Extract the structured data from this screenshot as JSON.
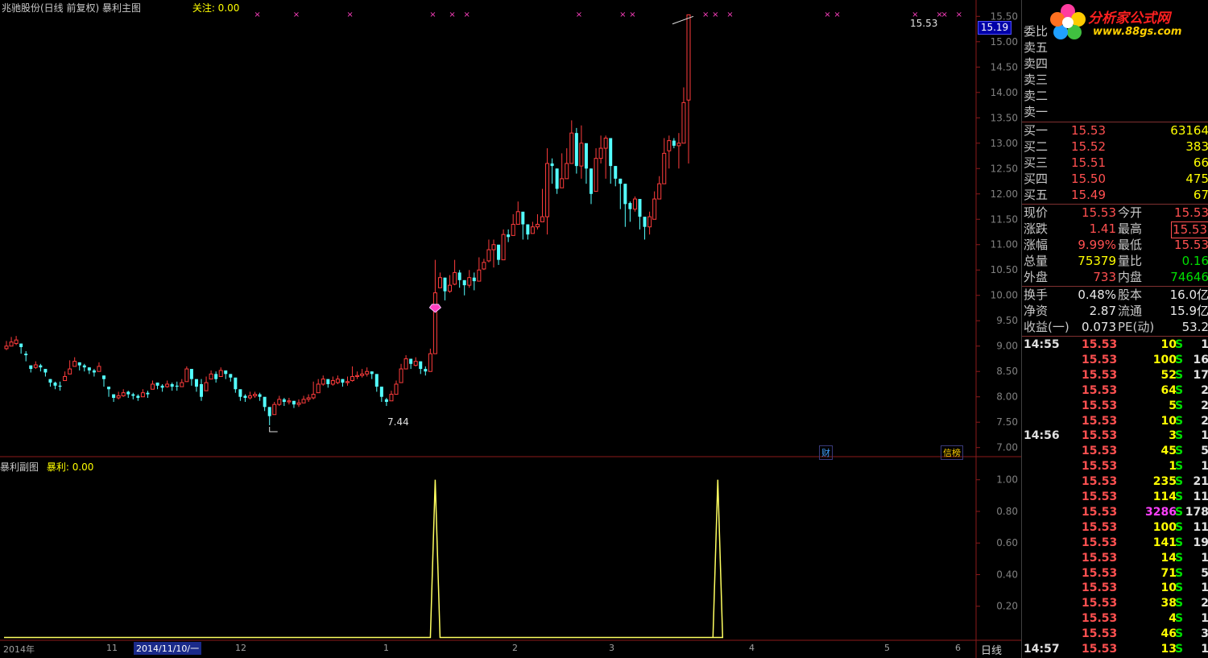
{
  "header": {
    "title": "兆驰股份(日线 前复权) 暴利主图",
    "focus_label": "关注: 0.00"
  },
  "sub_header": {
    "title": "暴利副图",
    "value_label": "暴利: 0.00"
  },
  "price_tag": "15.19",
  "annotations": {
    "high_label": "15.53",
    "low_label": "7.44",
    "finance_flag": "财",
    "rank_flag": "信榜"
  },
  "period_label": "日线",
  "date_axis": {
    "year": "2014年",
    "m11": "11",
    "selected": "2014/11/10/一",
    "m12": "12",
    "m1": "1",
    "m2": "2",
    "m3": "3",
    "m4": "4",
    "m5": "5",
    "m6": "6"
  },
  "colors": {
    "up": "#ff3c3c",
    "down": "#54ffff",
    "indicator": "#ffff60",
    "marker": "#ff40c0",
    "grid": "#8b1a1a"
  },
  "chart_data": [
    {
      "type": "candlestick",
      "title": "兆驰股份(日线 前复权) 暴利主图",
      "ylim": [
        6.9,
        15.6
      ],
      "y_ticks": [
        "15.50",
        "15.00",
        "14.50",
        "14.00",
        "13.50",
        "13.00",
        "12.50",
        "12.00",
        "11.50",
        "11.00",
        "10.50",
        "10.00",
        "9.50",
        "9.00",
        "8.50",
        "8.00",
        "7.50",
        "7.00"
      ],
      "closes": [
        9.0,
        9.08,
        9.12,
        8.98,
        8.82,
        8.55,
        8.63,
        8.58,
        8.48,
        8.28,
        8.22,
        8.2,
        8.4,
        8.55,
        8.7,
        8.62,
        8.58,
        8.52,
        8.48,
        8.6,
        8.35,
        8.15,
        7.98,
        8.02,
        8.08,
        8.05,
        8.02,
        7.98,
        8.08,
        8.05,
        8.25,
        8.22,
        8.18,
        8.25,
        8.2,
        8.2,
        8.28,
        8.55,
        8.35,
        8.2,
        8.0,
        8.28,
        8.45,
        8.35,
        8.52,
        8.45,
        8.38,
        8.15,
        8.0,
        7.98,
        8.02,
        8.05,
        8.0,
        7.8,
        7.62,
        7.85,
        7.95,
        7.9,
        7.92,
        7.85,
        7.88,
        7.95,
        7.98,
        8.05,
        8.25,
        8.35,
        8.25,
        8.32,
        8.35,
        8.28,
        8.3,
        8.4,
        8.42,
        8.45,
        8.5,
        8.45,
        8.2,
        8.0,
        7.9,
        8.05,
        8.25,
        8.55,
        8.75,
        8.65,
        8.7,
        8.55,
        8.5,
        8.85,
        10.05,
        10.35,
        10.08,
        10.2,
        10.45,
        10.3,
        10.2,
        10.35,
        10.28,
        10.5,
        10.65,
        10.9,
        11.0,
        10.7,
        11.2,
        11.15,
        11.4,
        11.65,
        11.4,
        11.2,
        11.35,
        11.4,
        11.55,
        12.6,
        12.55,
        12.1,
        12.3,
        12.6,
        13.2,
        12.55,
        13.0,
        12.5,
        12.0,
        12.7,
        12.9,
        13.1,
        12.55,
        12.3,
        12.2,
        11.8,
        11.7,
        11.9,
        11.55,
        11.35,
        11.55,
        11.9,
        12.2,
        12.8,
        13.05,
        12.95,
        13.0,
        13.8,
        15.53
      ],
      "highs": [
        9.1,
        9.18,
        9.2,
        9.05,
        8.9,
        8.62,
        8.7,
        8.65,
        8.55,
        8.35,
        8.3,
        8.3,
        8.5,
        8.72,
        8.78,
        8.68,
        8.65,
        8.58,
        8.55,
        8.68,
        8.42,
        8.2,
        8.05,
        8.1,
        8.15,
        8.12,
        8.08,
        8.05,
        8.15,
        8.12,
        8.32,
        8.28,
        8.25,
        8.32,
        8.28,
        8.3,
        8.35,
        8.6,
        8.4,
        8.28,
        8.35,
        8.4,
        8.52,
        8.5,
        8.58,
        8.5,
        8.45,
        8.22,
        8.08,
        8.05,
        8.1,
        8.1,
        8.08,
        7.9,
        7.72,
        7.9,
        8.02,
        7.98,
        7.98,
        7.92,
        7.95,
        8.02,
        8.05,
        8.3,
        8.35,
        8.42,
        8.3,
        8.4,
        8.42,
        8.35,
        8.4,
        8.6,
        8.5,
        8.55,
        8.58,
        8.5,
        8.3,
        8.1,
        7.98,
        8.12,
        8.32,
        8.65,
        8.82,
        8.75,
        8.78,
        8.62,
        8.6,
        8.95,
        10.7,
        10.45,
        10.35,
        10.4,
        10.7,
        10.5,
        10.3,
        10.5,
        10.45,
        10.75,
        10.72,
        11.1,
        11.1,
        10.95,
        11.3,
        11.3,
        11.6,
        11.85,
        11.5,
        11.4,
        11.45,
        11.6,
        12.1,
        12.9,
        12.7,
        12.5,
        12.8,
        12.9,
        13.45,
        13.3,
        13.35,
        12.7,
        12.5,
        12.9,
        13.15,
        13.15,
        12.7,
        12.55,
        12.3,
        12.0,
        11.85,
        11.95,
        11.7,
        11.45,
        11.65,
        12.05,
        12.35,
        13.1,
        13.15,
        13.1,
        13.2,
        14.1,
        15.53
      ],
      "lows": [
        8.92,
        9.0,
        9.02,
        8.85,
        8.7,
        8.48,
        8.55,
        8.5,
        8.4,
        8.2,
        8.15,
        8.12,
        8.32,
        8.45,
        8.6,
        8.52,
        8.5,
        8.45,
        8.4,
        8.5,
        8.2,
        8.0,
        7.9,
        7.95,
        8.0,
        7.98,
        7.95,
        7.92,
        8.0,
        7.98,
        8.15,
        8.15,
        8.1,
        8.18,
        8.12,
        8.12,
        8.2,
        8.3,
        8.22,
        8.1,
        7.92,
        8.18,
        8.35,
        8.28,
        8.4,
        8.35,
        8.3,
        8.08,
        7.92,
        7.9,
        7.95,
        7.98,
        7.92,
        7.72,
        7.44,
        7.7,
        7.82,
        7.82,
        7.85,
        7.78,
        7.8,
        7.88,
        7.9,
        7.95,
        8.1,
        8.22,
        8.18,
        8.22,
        8.25,
        8.2,
        8.22,
        8.3,
        8.35,
        8.38,
        8.4,
        8.35,
        8.1,
        7.9,
        7.82,
        7.95,
        8.15,
        8.45,
        8.62,
        8.55,
        8.6,
        8.45,
        8.42,
        8.72,
        9.95,
        10.2,
        9.9,
        10.05,
        10.2,
        10.15,
        10.0,
        10.15,
        10.1,
        10.4,
        10.5,
        10.65,
        10.55,
        10.6,
        10.95,
        11.05,
        11.2,
        11.4,
        11.1,
        11.1,
        11.25,
        11.3,
        11.45,
        11.2,
        12.2,
        12.0,
        12.2,
        12.5,
        12.6,
        12.4,
        12.3,
        12.2,
        11.8,
        12.5,
        12.6,
        12.3,
        12.2,
        12.15,
        11.7,
        11.35,
        11.45,
        11.65,
        11.3,
        11.1,
        11.2,
        11.8,
        12.0,
        12.5,
        12.5,
        12.9,
        12.5,
        13.0,
        12.6
      ],
      "opens": [
        8.95,
        9.0,
        9.05,
        9.05,
        8.85,
        8.62,
        8.58,
        8.62,
        8.55,
        8.35,
        8.28,
        8.22,
        8.32,
        8.45,
        8.6,
        8.68,
        8.62,
        8.58,
        8.52,
        8.5,
        8.42,
        8.2,
        8.05,
        7.98,
        8.02,
        8.1,
        8.05,
        8.02,
        8.0,
        8.08,
        8.15,
        8.28,
        8.22,
        8.2,
        8.25,
        8.22,
        8.2,
        8.3,
        8.55,
        8.35,
        8.25,
        8.12,
        8.35,
        8.45,
        8.4,
        8.52,
        8.45,
        8.38,
        8.15,
        8.02,
        7.98,
        8.02,
        8.05,
        8.0,
        7.8,
        7.65,
        7.85,
        7.95,
        7.9,
        7.92,
        7.85,
        7.88,
        7.95,
        7.98,
        8.08,
        8.25,
        8.35,
        8.25,
        8.28,
        8.35,
        8.28,
        8.32,
        8.4,
        8.42,
        8.45,
        8.5,
        8.45,
        8.2,
        7.95,
        7.92,
        8.05,
        8.28,
        8.55,
        8.75,
        8.62,
        8.7,
        8.55,
        8.5,
        8.85,
        10.15,
        10.35,
        10.08,
        10.22,
        10.45,
        10.3,
        10.2,
        10.35,
        10.28,
        10.52,
        10.68,
        10.9,
        11.0,
        10.7,
        11.2,
        11.18,
        11.4,
        11.65,
        11.4,
        11.22,
        11.35,
        11.45,
        11.55,
        12.6,
        12.5,
        12.12,
        12.3,
        12.6,
        13.2,
        12.55,
        13.0,
        12.5,
        12.05,
        12.7,
        12.9,
        13.1,
        12.55,
        12.3,
        12.2,
        11.82,
        11.7,
        11.9,
        11.55,
        11.35,
        11.5,
        11.9,
        12.2,
        12.85,
        13.05,
        12.95,
        13.0,
        13.85
      ]
    },
    {
      "type": "line",
      "title": "暴利副图",
      "series": [
        {
          "name": "暴利",
          "peak_indices": [
            88,
            146
          ],
          "peak_value": 1.0
        }
      ],
      "ylim": [
        0,
        1.08
      ],
      "y_ticks": [
        "1.00",
        "0.80",
        "0.60",
        "0.40",
        "0.20"
      ]
    }
  ],
  "quote_panel": {
    "logo_brand": "分析家公式网",
    "logo_url": "www.88gs.com",
    "weibi_label": "委比",
    "asks": [
      {
        "label": "卖五"
      },
      {
        "label": "卖四"
      },
      {
        "label": "卖三"
      },
      {
        "label": "卖二"
      },
      {
        "label": "卖一"
      }
    ],
    "bids": [
      {
        "label": "买一",
        "price": "15.53",
        "vol": "63164"
      },
      {
        "label": "买二",
        "price": "15.52",
        "vol": "383"
      },
      {
        "label": "买三",
        "price": "15.51",
        "vol": "66"
      },
      {
        "label": "买四",
        "price": "15.50",
        "vol": "475"
      },
      {
        "label": "买五",
        "price": "15.49",
        "vol": "67"
      }
    ],
    "stats": [
      {
        "l1": "现价",
        "v1": "15.53",
        "l2": "今开",
        "v2": "15.53"
      },
      {
        "l1": "涨跌",
        "v1": "1.41",
        "l2": "最高",
        "v2": "15.53"
      },
      {
        "l1": "涨幅",
        "v1": "9.99%",
        "l2": "最低",
        "v2": "15.53"
      },
      {
        "l1": "总量",
        "v1": "75379",
        "l2": "量比",
        "v2": "0.16"
      },
      {
        "l1": "外盘",
        "v1": "733",
        "l2": "内盘",
        "v2": "74646"
      }
    ],
    "fund": [
      {
        "l1": "换手",
        "v1": "0.48%",
        "l2": "股本",
        "v2": "16.0亿"
      },
      {
        "l1": "净资",
        "v1": "2.87",
        "l2": "流通",
        "v2": "15.9亿"
      },
      {
        "l1": "收益(一)",
        "v1": "0.073",
        "l2": "PE(动)",
        "v2": "53.2"
      }
    ],
    "ticks": [
      {
        "time": "14:55",
        "price": "15.53",
        "qty": "10",
        "side": "S",
        "num": "1"
      },
      {
        "time": "",
        "price": "15.53",
        "qty": "100",
        "side": "S",
        "num": "16"
      },
      {
        "time": "",
        "price": "15.53",
        "qty": "52",
        "side": "S",
        "num": "17"
      },
      {
        "time": "",
        "price": "15.53",
        "qty": "64",
        "side": "S",
        "num": "2"
      },
      {
        "time": "",
        "price": "15.53",
        "qty": "5",
        "side": "S",
        "num": "2"
      },
      {
        "time": "",
        "price": "15.53",
        "qty": "10",
        "side": "S",
        "num": "2"
      },
      {
        "time": "14:56",
        "price": "15.53",
        "qty": "3",
        "side": "S",
        "num": "1"
      },
      {
        "time": "",
        "price": "15.53",
        "qty": "45",
        "side": "S",
        "num": "5"
      },
      {
        "time": "",
        "price": "15.53",
        "qty": "1",
        "side": "S",
        "num": "1"
      },
      {
        "time": "",
        "price": "15.53",
        "qty": "235",
        "side": "S",
        "num": "21"
      },
      {
        "time": "",
        "price": "15.53",
        "qty": "114",
        "side": "S",
        "num": "11"
      },
      {
        "time": "",
        "price": "15.53",
        "qty": "3286",
        "side": "S",
        "num": "178"
      },
      {
        "time": "",
        "price": "15.53",
        "qty": "100",
        "side": "S",
        "num": "11"
      },
      {
        "time": "",
        "price": "15.53",
        "qty": "141",
        "side": "S",
        "num": "19"
      },
      {
        "time": "",
        "price": "15.53",
        "qty": "14",
        "side": "S",
        "num": "1"
      },
      {
        "time": "",
        "price": "15.53",
        "qty": "71",
        "side": "S",
        "num": "5"
      },
      {
        "time": "",
        "price": "15.53",
        "qty": "10",
        "side": "S",
        "num": "1"
      },
      {
        "time": "",
        "price": "15.53",
        "qty": "38",
        "side": "S",
        "num": "2"
      },
      {
        "time": "",
        "price": "15.53",
        "qty": "4",
        "side": "S",
        "num": "1"
      },
      {
        "time": "",
        "price": "15.53",
        "qty": "46",
        "side": "S",
        "num": "3"
      },
      {
        "time": "14:57",
        "price": "15.53",
        "qty": "13",
        "side": "S",
        "num": "1"
      }
    ]
  }
}
